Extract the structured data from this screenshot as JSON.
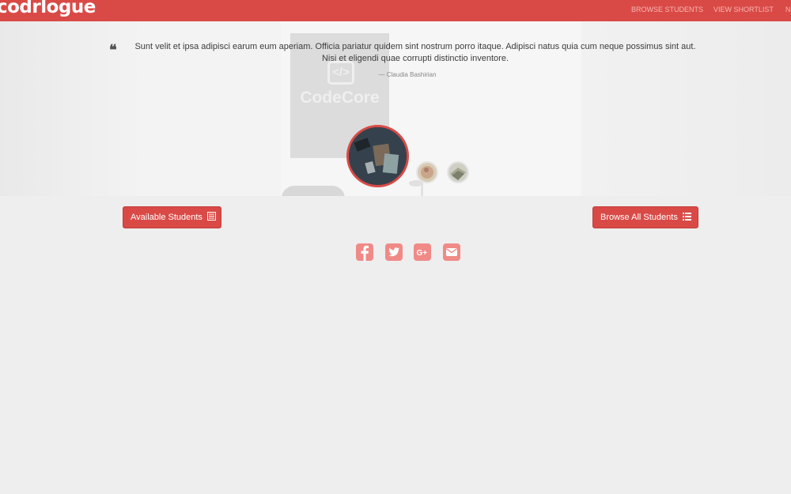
{
  "navbar": {
    "brand": "codrlogue",
    "links": [
      "BROWSE STUDENTS",
      "VIEW SHORTLIST",
      "N"
    ],
    "background": "#d94a46"
  },
  "hero": {
    "banner_text": "CodeCore",
    "banner_icon": "</>",
    "quote": {
      "text": "Sunt velit et ipsa adipisci earum eum aperiam. Officia pariatur quidem sint nostrum porro itaque. Adipisci natus quia cum neque possimus sint aut. Nisi et eligendi quae corrupti distinctio inventore.",
      "author": "— Claudia Bashirian",
      "icon": "quote-left-icon"
    }
  },
  "buttons": {
    "available": {
      "label": "Available Students",
      "icon": "list-alt-icon"
    },
    "browse_all": {
      "label": "Browse All Students",
      "icon": "list-icon"
    }
  },
  "social": [
    "facebook-icon",
    "twitter-icon",
    "google-plus-icon",
    "envelope-icon"
  ],
  "colors": {
    "accent": "#d94a46",
    "social": "#f08a87",
    "background": "#eeeeee"
  }
}
